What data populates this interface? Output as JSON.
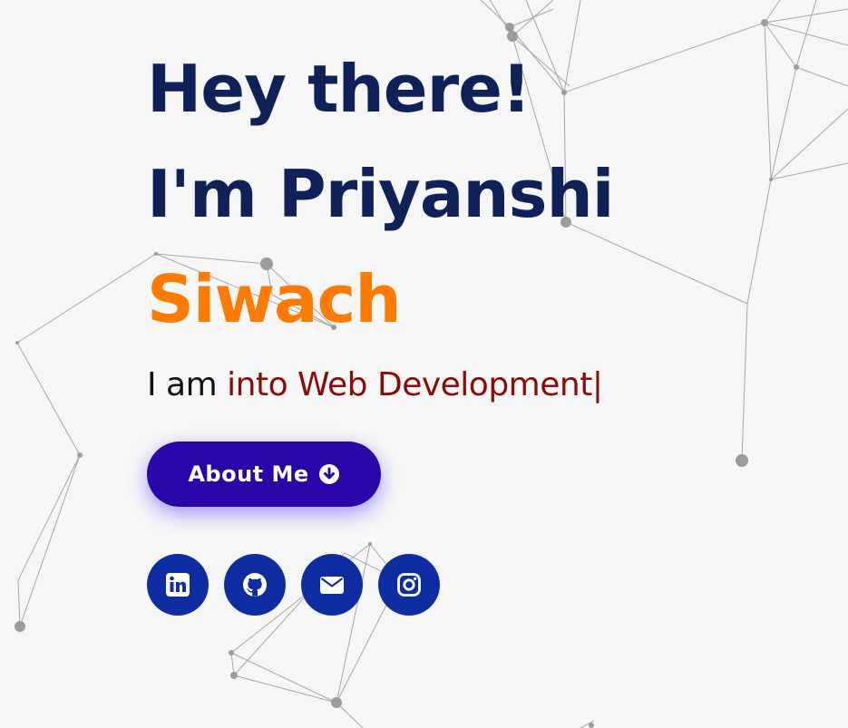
{
  "hero": {
    "greeting": "Hey there!",
    "intro": "I'm Priyanshi",
    "surname": "Siwach",
    "typing_prefix": "I am ",
    "typing_text": "into Web Development",
    "cursor": "|",
    "about_button_label": "About Me",
    "about_button_icon": "arrow-circle-down-icon"
  },
  "socials": [
    {
      "name": "LinkedIn",
      "icon": "linkedin-icon"
    },
    {
      "name": "GitHub",
      "icon": "github-icon"
    },
    {
      "name": "Email",
      "icon": "envelope-icon"
    },
    {
      "name": "Instagram",
      "icon": "instagram-icon"
    }
  ],
  "colors": {
    "background": "#f6f6f6",
    "heading": "#0e2158",
    "accent": "#ff7a00",
    "typing_text": "#8a0b0b",
    "button": "#2a06a8",
    "social_circle": "#0f2da3"
  }
}
